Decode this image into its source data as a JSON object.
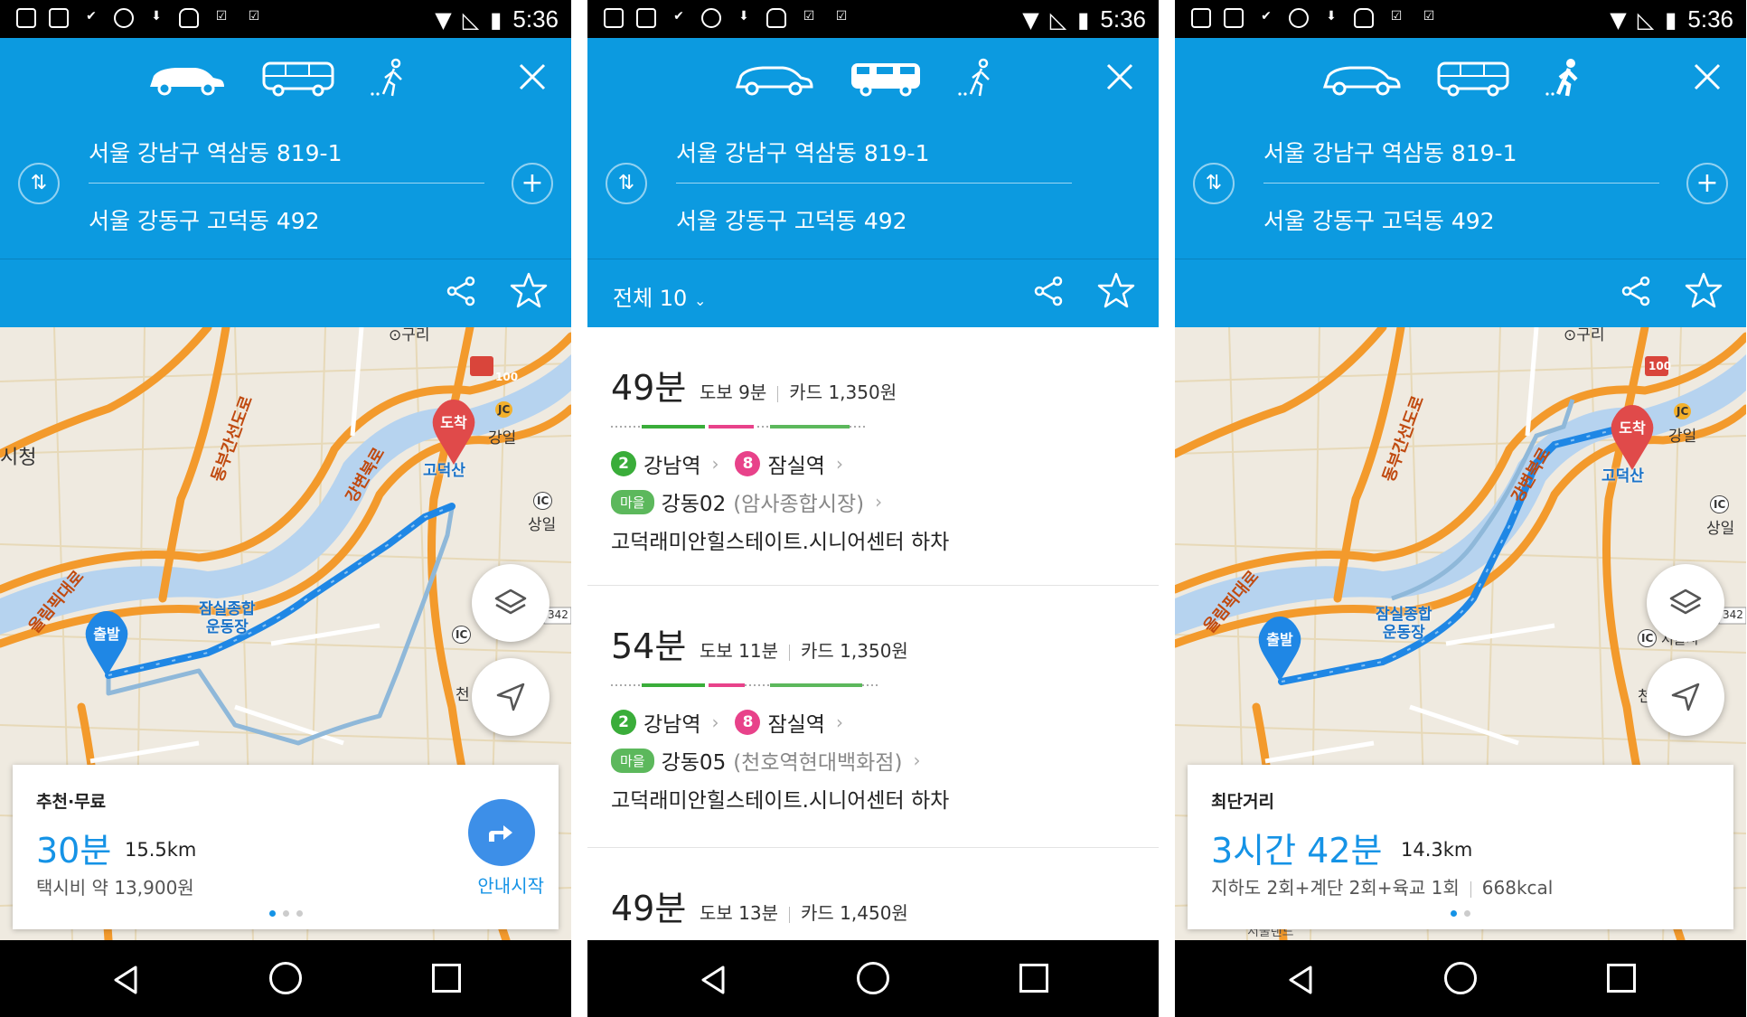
{
  "colors": {
    "header_blue": "#0c9ae0",
    "accent_blue": "#1593e6",
    "line2_green": "#3aad3a",
    "line8_pink": "#e8428a",
    "village_bus_green": "#5cb85c",
    "dest_pin_red": "#e04a4a",
    "start_pin_blue": "#1f87e5"
  },
  "status_bar": {
    "time": "5:36"
  },
  "origin": "서울 강남구 역삼동 819-1",
  "destination": "서울 강동구 고덕동 492",
  "map_labels": {
    "guri": "⊙구리",
    "goduksan": "고덕산",
    "gangil": "강일",
    "sangil": "상일",
    "stadium": "잠실종합\n운동장",
    "start": "출발",
    "arrive": "도착",
    "cheong": "시청",
    "chun": "천",
    "gangbyeon": "강변북로",
    "olympic": "올림픽대로",
    "dongbu": "동부간선도로",
    "shield_100": "100",
    "shield_342": "342",
    "jc": "JC",
    "ic": "IC",
    "seoulsi": "서울시",
    "seoul_land": "서울랜드"
  },
  "car_panel": {
    "tag": "추천·무료",
    "time": "30분",
    "distance": "15.5km",
    "sub": "택시비 약 13,900원",
    "guide_label": "안내시작"
  },
  "transit_panel": {
    "total_label": "전체 10",
    "routes": [
      {
        "time": "49분",
        "walk": "도보 9분",
        "fare": "카드 1,350원",
        "line2": "2",
        "stop1": "강남역",
        "line8": "8",
        "stop2": "잠실역",
        "bus_tag": "마을",
        "bus": "강동02",
        "bus_stop": "(암사종합시장)",
        "exit": "고덕래미안힐스테이트.시니어센터 하차"
      },
      {
        "time": "54분",
        "walk": "도보 11분",
        "fare": "카드 1,350원",
        "line2": "2",
        "stop1": "강남역",
        "line8": "8",
        "stop2": "잠실역",
        "bus_tag": "마을",
        "bus": "강동05",
        "bus_stop": "(천호역현대백화점)",
        "exit": "고덕래미안힐스테이트.시니어센터 하차"
      },
      {
        "time": "49분",
        "walk": "도보 13분",
        "fare": "카드 1,450원"
      }
    ]
  },
  "walk_panel": {
    "tag": "최단거리",
    "time": "3시간 42분",
    "distance": "14.3km",
    "sub": "지하도 2회+계단 2회+육교 1회",
    "kcal": "668kcal"
  }
}
